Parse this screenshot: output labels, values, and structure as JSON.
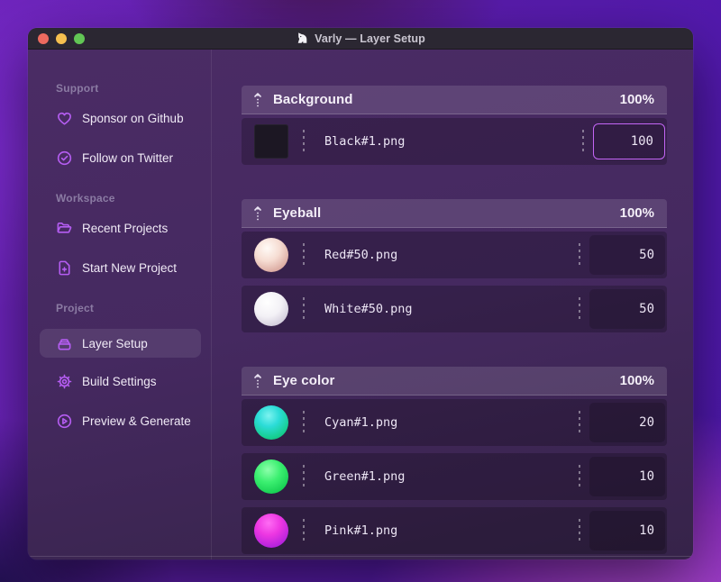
{
  "window": {
    "title": "Varly — Layer Setup",
    "traffic_lights": [
      "close",
      "minimize",
      "zoom"
    ]
  },
  "colors": {
    "accent_violet": "#b55df2",
    "focused_input_border": "#c365f5",
    "titlebar_bg": "#2b2732",
    "window_bg": "#45295f",
    "row_bg": "#39234f",
    "header_bg": "#564070"
  },
  "sidebar": {
    "sections": [
      {
        "label": "Support",
        "items": [
          {
            "id": "sponsor-github",
            "icon": "heart-icon",
            "label": "Sponsor on Github",
            "active": false
          },
          {
            "id": "follow-twitter",
            "icon": "check-badge-icon",
            "label": "Follow on Twitter",
            "active": false
          }
        ]
      },
      {
        "label": "Workspace",
        "items": [
          {
            "id": "recent-projects",
            "icon": "folder-icon",
            "label": "Recent Projects",
            "active": false
          },
          {
            "id": "start-new-project",
            "icon": "document-plus-icon",
            "label": "Start New Project",
            "active": false
          }
        ]
      },
      {
        "label": "Project",
        "items": [
          {
            "id": "layer-setup",
            "icon": "layers-icon",
            "label": "Layer Setup",
            "active": true
          },
          {
            "id": "build-settings",
            "icon": "gear-icon",
            "label": "Build Settings",
            "active": false
          },
          {
            "id": "preview-generate",
            "icon": "play-circle-icon",
            "label": "Preview & Generate",
            "active": false
          }
        ]
      }
    ]
  },
  "layers": {
    "groups": [
      {
        "name": "Background",
        "weight": "100%",
        "items": [
          {
            "file": "Black#1.png",
            "value": "100",
            "swatch": "black-square",
            "focused": true
          }
        ]
      },
      {
        "name": "Eyeball",
        "weight": "100%",
        "items": [
          {
            "file": "Red#50.png",
            "value": "50",
            "swatch": "red-sphere",
            "focused": false
          },
          {
            "file": "White#50.png",
            "value": "50",
            "swatch": "white-sphere",
            "focused": false
          }
        ]
      },
      {
        "name": "Eye color",
        "weight": "100%",
        "items": [
          {
            "file": "Cyan#1.png",
            "value": "20",
            "swatch": "cyan-sphere",
            "focused": false
          },
          {
            "file": "Green#1.png",
            "value": "10",
            "swatch": "green-sphere",
            "focused": false
          },
          {
            "file": "Pink#1.png",
            "value": "10",
            "swatch": "pink-sphere",
            "focused": false
          }
        ]
      }
    ]
  }
}
